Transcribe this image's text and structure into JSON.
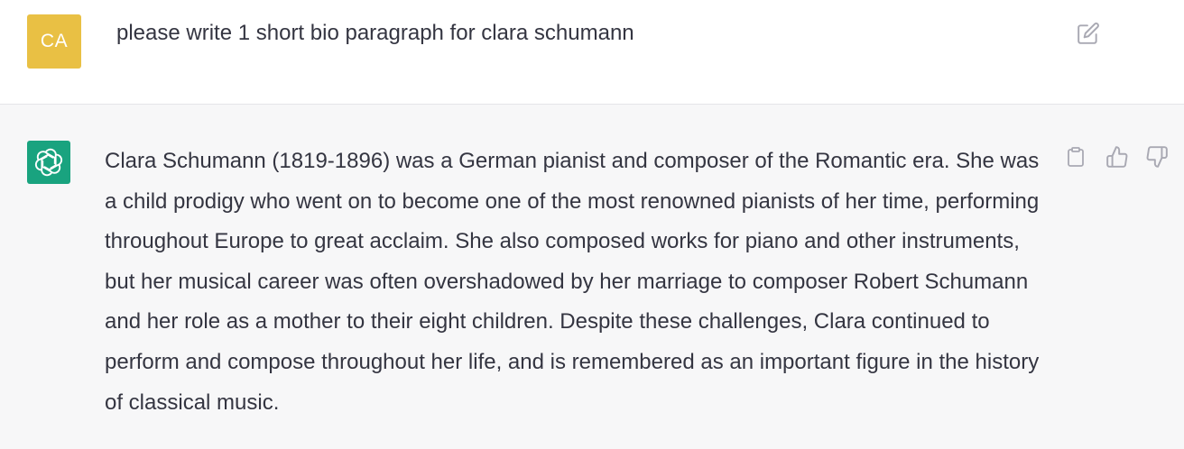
{
  "user_turn": {
    "avatar_initials": "CA",
    "avatar_color": "#e9c044",
    "message": "please write 1 short bio paragraph for clara schumann",
    "edit_icon": "edit-icon"
  },
  "assistant_turn": {
    "avatar_icon": "openai-logo-icon",
    "avatar_color": "#19a37f",
    "message": "Clara Schumann (1819-1896) was a German pianist and composer of the Romantic era. She was a child prodigy who went on to become one of the most renowned pianists of her time, performing throughout Europe to great acclaim. She also composed works for piano and other instruments, but her musical career was often overshadowed by her marriage to composer Robert Schumann and her role as a mother to their eight children. Despite these challenges, Clara continued to perform and compose throughout her life, and is remembered as an important figure in the history of classical music.",
    "actions": [
      "clipboard-icon",
      "thumbs-up-icon",
      "thumbs-down-icon"
    ]
  },
  "colors": {
    "user_row_bg": "#ffffff",
    "assistant_row_bg": "#f7f7f8",
    "text": "#343541",
    "icon": "#a9a9b3"
  }
}
